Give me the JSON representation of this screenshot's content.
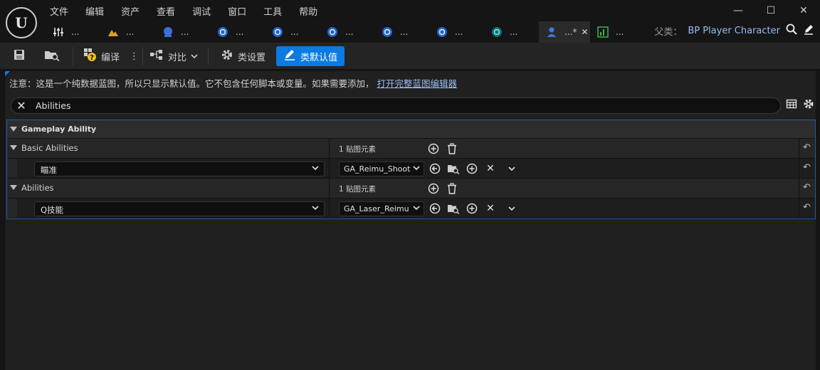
{
  "menu": [
    "文件",
    "编辑",
    "资产",
    "查看",
    "调试",
    "窗口",
    "工具",
    "帮助"
  ],
  "tabs": [
    {
      "icon": "sliders-icon",
      "label": "..."
    },
    {
      "icon": "mountain-icon",
      "label": "..."
    },
    {
      "icon": "sphere-icon",
      "label": "..."
    },
    {
      "icon": "blueprint-circle-icon",
      "label": "..."
    },
    {
      "icon": "blueprint-circle-icon",
      "label": "..."
    },
    {
      "icon": "blueprint-circle-icon",
      "label": "..."
    },
    {
      "icon": "blueprint-circle-icon",
      "label": "..."
    },
    {
      "icon": "blueprint-circle-icon",
      "label": "..."
    },
    {
      "icon": "teal-circle-icon",
      "label": "..."
    },
    {
      "icon": "person-icon",
      "label": "...*",
      "active": true
    },
    {
      "icon": "chart-icon",
      "label": "..."
    }
  ],
  "parent": {
    "label": "父类：",
    "value": "BP Player Character"
  },
  "toolbar": {
    "compile": "编译",
    "diff": "对比",
    "class_settings": "类设置",
    "class_defaults": "类默认值"
  },
  "notice": {
    "text": "注意：这是一个纯数据蓝图，所以只显示默认值。它不包含任何脚本或变量。如果需要添加，",
    "link": "打开完整蓝图编辑器"
  },
  "search": {
    "value": "Abilities"
  },
  "details": {
    "category": "Gameplay Ability",
    "groups": [
      {
        "label": "Basic Abilities",
        "count": "1 贴图元素",
        "key": "瞄准",
        "value": "GA_Reimu_Shoot"
      },
      {
        "label": "Abilities",
        "count": "1 贴图元素",
        "key": "Q技能",
        "value": "GA_Laser_Reimu"
      }
    ]
  },
  "colors": {
    "accent": "#0b7be0",
    "link": "#9bbcf0",
    "selection_border": "#1f5ea8"
  }
}
